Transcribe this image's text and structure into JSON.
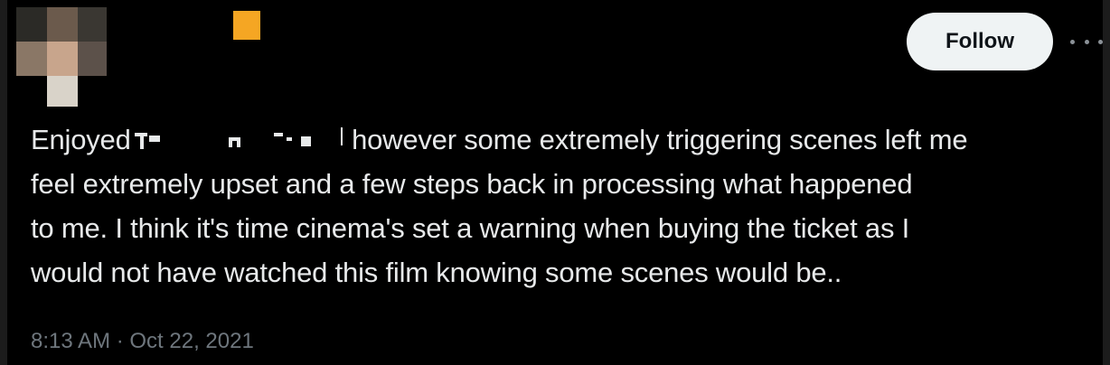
{
  "header": {
    "follow_label": "Follow",
    "more_icon": "more-horizontal-icon",
    "name_redaction_color": "#f5a623"
  },
  "tweet": {
    "text_prefix": "Enjoyed",
    "text_line1_suffix": "however some extremely triggering scenes left me",
    "text_line2": "feel extremely upset and a few steps back in processing what happened",
    "text_line3": "to me. I think it's time cinema's set a warning when buying the ticket as I",
    "text_line4": "would not have watched this film knowing some scenes would be..",
    "timestamp": "8:13 AM · Oct 22, 2021"
  },
  "colors": {
    "background": "#000000",
    "text": "#e7e9ea",
    "muted": "#6e767d",
    "button_bg": "#eff3f4"
  }
}
